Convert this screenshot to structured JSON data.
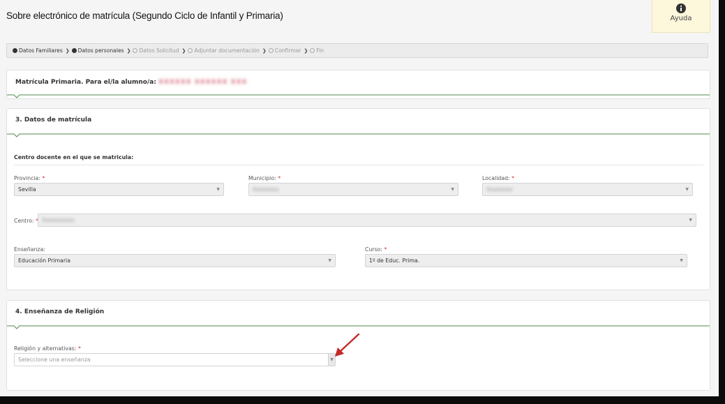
{
  "header": {
    "title": "Sobre electrónico de matrícula (Segundo Ciclo de Infantil y Primaria)",
    "help_label": "Ayuda"
  },
  "steps": [
    {
      "label": "Datos Familiares",
      "state": "done"
    },
    {
      "label": "Datos personales",
      "state": "done"
    },
    {
      "label": "Datos Solicitud",
      "state": "todo"
    },
    {
      "label": "Adjuntar documentación",
      "state": "todo"
    },
    {
      "label": "Confirmar",
      "state": "todo"
    },
    {
      "label": "Fin",
      "state": "todo"
    }
  ],
  "student_panel": {
    "title": "Matrícula Primaria. Para el/la alumno/a:",
    "student_name_redacted": "XXXXXX XXXXXX XXX"
  },
  "enrollment": {
    "title": "3. Datos de matrícula",
    "subsection": "Centro docente en el que se matricula:",
    "required_mark": "*",
    "provincia": {
      "label": "Provincia:",
      "value": "Sevilla"
    },
    "municipio": {
      "label": "Municipio:",
      "value": "Xxxxxxxx"
    },
    "localidad": {
      "label": "Localidad:",
      "value": "Xxxxxxxx"
    },
    "centro": {
      "label": "Centro:",
      "value": "Xxxxxxxxxx"
    },
    "ensenanza": {
      "label": "Enseñanza:",
      "value": "Educación Primaria"
    },
    "curso": {
      "label": "Curso:",
      "value": "1º de Educ. Prima."
    }
  },
  "religion": {
    "title": "4. Enseñanza de Religión",
    "label": "Religión y alternativas:",
    "placeholder": "Seleccione una enseñanza"
  },
  "colors": {
    "accent_green": "#4f8a4f",
    "required_red": "#d32f2f",
    "annotation_arrow": "#c62828"
  },
  "icons": {
    "help": "info-circle-icon",
    "step_done": "check-circle-icon",
    "step_todo": "circle-outline-icon",
    "step_separator": "chevron-right-icon",
    "select_caret": "caret-down-icon"
  }
}
